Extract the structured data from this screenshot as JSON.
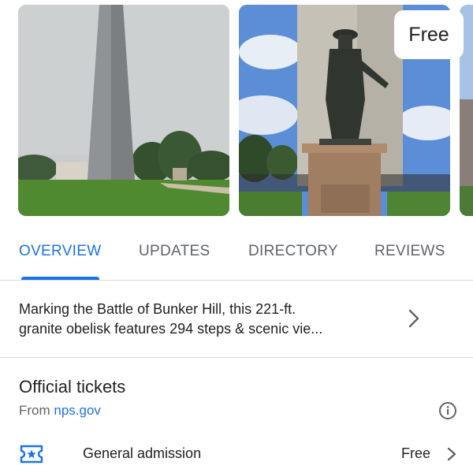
{
  "carousel": {
    "badge": "Free",
    "photos": [
      {
        "icon": "obelisk-photo"
      },
      {
        "icon": "statue-photo"
      },
      {
        "icon": "city-photo"
      }
    ]
  },
  "tabs": [
    {
      "label": "OVERVIEW",
      "active": true
    },
    {
      "label": "UPDATES",
      "active": false
    },
    {
      "label": "DIRECTORY",
      "active": false
    },
    {
      "label": "REVIEWS",
      "active": false
    }
  ],
  "description": {
    "line1": "Marking the Battle of Bunker Hill, this 221-ft.",
    "line2": "granite obelisk features 294 steps & scenic vie..."
  },
  "tickets": {
    "title": "Official tickets",
    "source_prefix": "From ",
    "source_link": "nps.gov",
    "item_label": "General admission",
    "item_price": "Free"
  },
  "colors": {
    "accent": "#1a73e8",
    "text": "#202124",
    "muted": "#5f6368",
    "divider": "#dadce0"
  }
}
